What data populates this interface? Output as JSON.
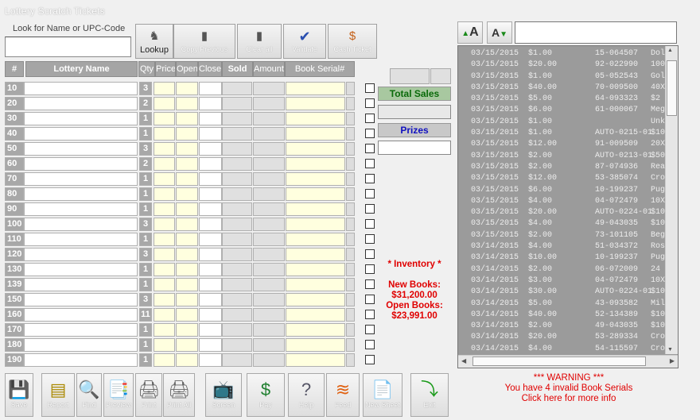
{
  "window": {
    "title": "Lottery Scratch Tickets"
  },
  "search": {
    "label": "Look for Name or UPC-Code",
    "value": ""
  },
  "toolbar": [
    {
      "label": "Lookup",
      "icon": "binoculars-icon"
    },
    {
      "label": "Copy Previous",
      "icon": "copy-icon"
    },
    {
      "label": "Clear all",
      "icon": "clear-icon"
    },
    {
      "label": "Validate",
      "icon": "checkmark-icon"
    },
    {
      "label": "Cash Ticket",
      "icon": "money-bag-icon"
    }
  ],
  "columns": {
    "num": "#",
    "name": "Lottery Name",
    "qty": "Qty",
    "price": "Price",
    "open": "Open",
    "close": "Close",
    "sold": "Sold",
    "amount": "Amount",
    "serial": "Book Serial#"
  },
  "rows": [
    {
      "num": "10",
      "qty": "3"
    },
    {
      "num": "20",
      "qty": "2"
    },
    {
      "num": "30",
      "qty": "1"
    },
    {
      "num": "40",
      "qty": "1"
    },
    {
      "num": "50",
      "qty": "3"
    },
    {
      "num": "60",
      "qty": "2"
    },
    {
      "num": "70",
      "qty": "1"
    },
    {
      "num": "80",
      "qty": "1"
    },
    {
      "num": "90",
      "qty": "1"
    },
    {
      "num": "100",
      "qty": "3"
    },
    {
      "num": "110",
      "qty": "1"
    },
    {
      "num": "120",
      "qty": "3"
    },
    {
      "num": "130",
      "qty": "1"
    },
    {
      "num": "139",
      "qty": "1"
    },
    {
      "num": "150",
      "qty": "3"
    },
    {
      "num": "160",
      "qty": "11"
    },
    {
      "num": "170",
      "qty": "1"
    },
    {
      "num": "180",
      "qty": "1"
    },
    {
      "num": "190",
      "qty": "1"
    }
  ],
  "sidebar": {
    "total_sales_label": "Total Sales",
    "total_sales_value": "",
    "prizes_label": "Prizes",
    "prizes_value": ""
  },
  "inventory": {
    "title": "* Inventory *",
    "new_books_label": "New Books:",
    "new_books_value": "$31,200.00",
    "open_books_label": "Open Books:",
    "open_books_value": "$23,991.00"
  },
  "font_controls": {
    "increase_icon": "font-increase-icon",
    "decrease_icon": "font-decrease-icon",
    "input_value": ""
  },
  "log": [
    {
      "date": "03/15/2015",
      "amount": "$1.00",
      "serial": "15-064507",
      "tail": "Dol"
    },
    {
      "date": "03/15/2015",
      "amount": "$20.00",
      "serial": "92-022990",
      "tail": "100"
    },
    {
      "date": "03/15/2015",
      "amount": "$1.00",
      "serial": "05-052543",
      "tail": "Gol"
    },
    {
      "date": "03/15/2015",
      "amount": "$40.00",
      "serial": "70-009500",
      "tail": "40X"
    },
    {
      "date": "03/15/2015",
      "amount": "$5.00",
      "serial": "64-093323",
      "tail": "$2"
    },
    {
      "date": "03/15/2015",
      "amount": "$6.00",
      "serial": "61-000067",
      "tail": "Meg"
    },
    {
      "date": "03/15/2015",
      "amount": "$1.00",
      "serial": "",
      "tail": "Unk"
    },
    {
      "date": "03/15/2015",
      "amount": "$1.00",
      "serial": "AUTO-0215-01",
      "tail": "$10"
    },
    {
      "date": "03/15/2015",
      "amount": "$12.00",
      "serial": "91-009509",
      "tail": "20X"
    },
    {
      "date": "03/15/2015",
      "amount": "$2.00",
      "serial": "AUTO-0213-01",
      "tail": "$50"
    },
    {
      "date": "03/15/2015",
      "amount": "$2.00",
      "serial": "87-074936",
      "tail": "Rea"
    },
    {
      "date": "03/15/2015",
      "amount": "$12.00",
      "serial": "53-385074",
      "tail": "Cro"
    },
    {
      "date": "03/15/2015",
      "amount": "$6.00",
      "serial": "10-199237",
      "tail": "Pug"
    },
    {
      "date": "03/15/2015",
      "amount": "$4.00",
      "serial": "04-072479",
      "tail": "10X"
    },
    {
      "date": "03/15/2015",
      "amount": "$20.00",
      "serial": "AUTO-0224-01",
      "tail": "$10"
    },
    {
      "date": "03/15/2015",
      "amount": "$4.00",
      "serial": "49-043035",
      "tail": "$10"
    },
    {
      "date": "03/15/2015",
      "amount": "$2.00",
      "serial": "73-101105",
      "tail": "Beg"
    },
    {
      "date": "03/14/2015",
      "amount": "$4.00",
      "serial": "51-034372",
      "tail": "Ros"
    },
    {
      "date": "03/14/2015",
      "amount": "$10.00",
      "serial": "10-199237",
      "tail": "Pug"
    },
    {
      "date": "03/14/2015",
      "amount": "$2.00",
      "serial": "06-072009",
      "tail": "24"
    },
    {
      "date": "03/14/2015",
      "amount": "$3.00",
      "serial": "04-072479",
      "tail": "10X"
    },
    {
      "date": "03/14/2015",
      "amount": "$30.00",
      "serial": "AUTO-0224-01",
      "tail": "$10"
    },
    {
      "date": "03/14/2015",
      "amount": "$5.00",
      "serial": "43-093582",
      "tail": "Mil"
    },
    {
      "date": "03/14/2015",
      "amount": "$40.00",
      "serial": "52-134389",
      "tail": "$10"
    },
    {
      "date": "03/14/2015",
      "amount": "$2.00",
      "serial": "49-043035",
      "tail": "$10"
    },
    {
      "date": "03/14/2015",
      "amount": "$20.00",
      "serial": "53-289334",
      "tail": "Cro"
    },
    {
      "date": "03/14/2015",
      "amount": "$4.00",
      "serial": "54-115597",
      "tail": "Cro"
    }
  ],
  "bottom_buttons": [
    {
      "label": "Save",
      "icon": "floppy-disk-icon"
    },
    {
      "label": "Report",
      "icon": "document-icon"
    },
    {
      "label": "Find",
      "icon": "magnifier-icon"
    },
    {
      "label": "Preview",
      "icon": "preview-icon"
    },
    {
      "label": "Print",
      "icon": "printer-icon"
    },
    {
      "label": "Print All",
      "icon": "printer-all-icon"
    },
    {
      "label": "Screen",
      "icon": "monitor-icon"
    },
    {
      "label": "Pay",
      "icon": "dollar-icon"
    },
    {
      "label": "Help",
      "icon": "help-icon"
    },
    {
      "label": "Feed",
      "icon": "rss-icon"
    },
    {
      "label": "New Sheet",
      "icon": "new-page-icon"
    },
    {
      "label": "Exit",
      "icon": "exit-arrow-icon"
    }
  ],
  "warning": {
    "line1": "*** WARNING ***",
    "line2": "You have 4 invalid Book Serials",
    "line3": "Click here for more info"
  }
}
